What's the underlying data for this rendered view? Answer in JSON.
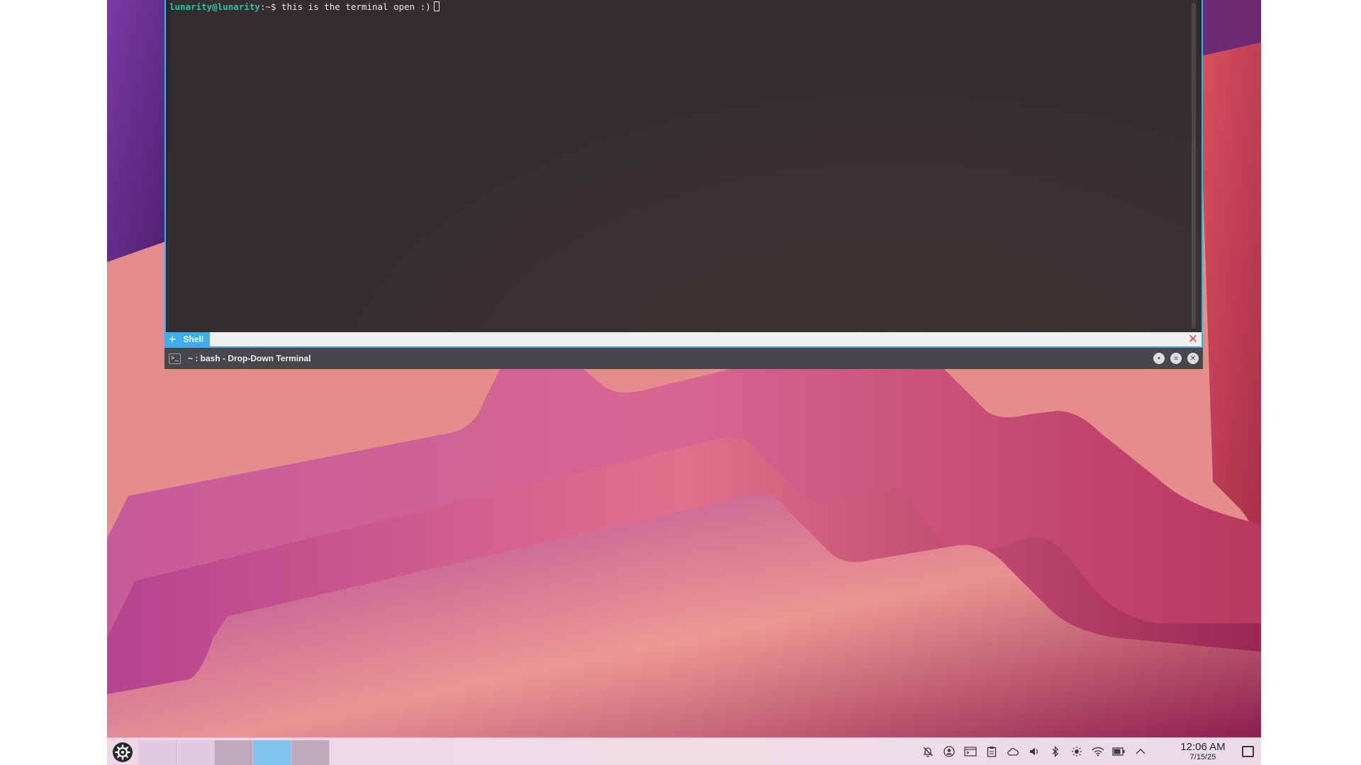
{
  "terminal": {
    "prompt_user": "lunarity@lunarity",
    "prompt_path": ":~$",
    "command": " this is the terminal open :)",
    "tab_plus": "+",
    "tab_label": "Shell",
    "tab_close_glyph": "✕",
    "window_title": "~ : bash - Drop-Down Terminal",
    "title_icon_glyph": ">_",
    "buttons": {
      "minimize": "•",
      "menu": "≡",
      "close": "✕"
    },
    "accent": "#3daee9"
  },
  "taskbar": {
    "launcher_icon": "kde-gear-icon",
    "desktops": [
      {
        "name": "desktop-1",
        "state": "empty"
      },
      {
        "name": "desktop-2",
        "state": "empty"
      },
      {
        "name": "desktop-3",
        "state": "occupied"
      },
      {
        "name": "desktop-4",
        "state": "active"
      },
      {
        "name": "desktop-5",
        "state": "occupied"
      }
    ],
    "tray": [
      {
        "name": "notifications-icon",
        "glyph": "🔔"
      },
      {
        "name": "user-icon",
        "glyph": "◉"
      },
      {
        "name": "terminal-icon",
        "glyph": "▭"
      },
      {
        "name": "clipboard-icon",
        "glyph": "▤"
      },
      {
        "name": "weather-icon",
        "glyph": "☁"
      },
      {
        "name": "volume-icon",
        "glyph": "🔊"
      },
      {
        "name": "bluetooth-icon",
        "glyph": "ᛒ"
      },
      {
        "name": "brightness-icon",
        "glyph": "☀"
      },
      {
        "name": "wifi-icon",
        "glyph": "⌔"
      },
      {
        "name": "battery-icon",
        "glyph": "▮"
      },
      {
        "name": "expand-tray-icon",
        "glyph": "⌃"
      }
    ],
    "clock_time": "12:06 AM",
    "clock_date": "7/15/25"
  }
}
